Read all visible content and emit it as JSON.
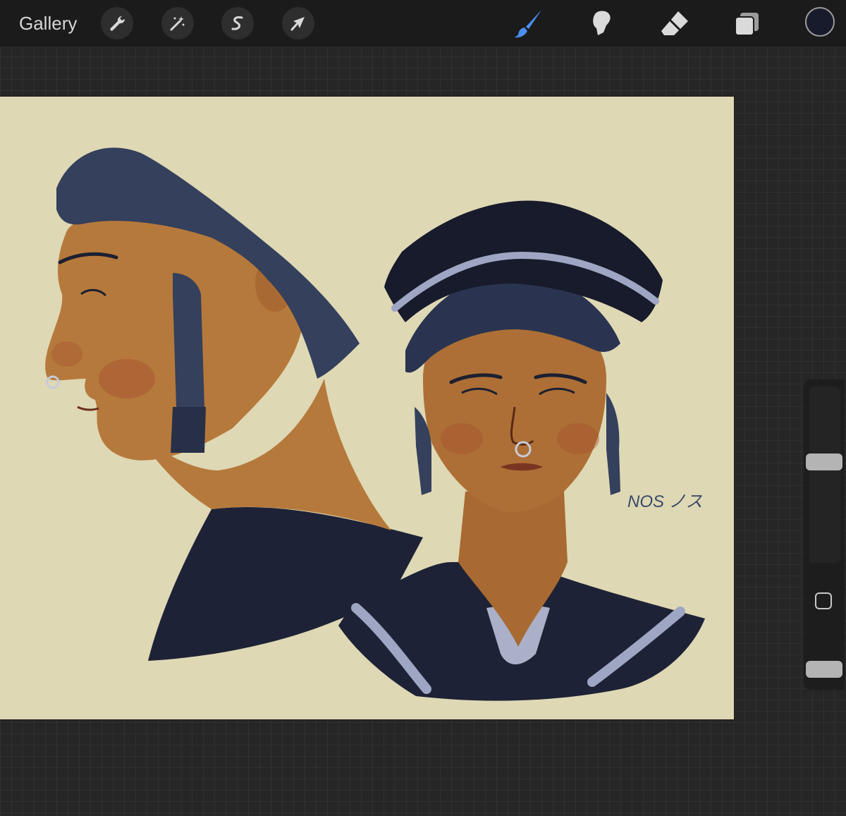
{
  "toolbar": {
    "gallery_label": "Gallery",
    "left_tools": [
      "wrench-icon",
      "magic-wand-icon",
      "selection-s-icon",
      "transform-arrow-icon"
    ],
    "right_tools": [
      "brush-icon",
      "smudge-icon",
      "eraser-icon",
      "layers-icon"
    ],
    "active_tool": "brush-icon",
    "active_color": "#4a8ef5",
    "current_color": "#181b2b"
  },
  "canvas": {
    "background": "#ded8b4",
    "signature": "NOS ノス"
  },
  "sidebar": {
    "size_level": 0.58,
    "opacity_level": 0.15
  }
}
